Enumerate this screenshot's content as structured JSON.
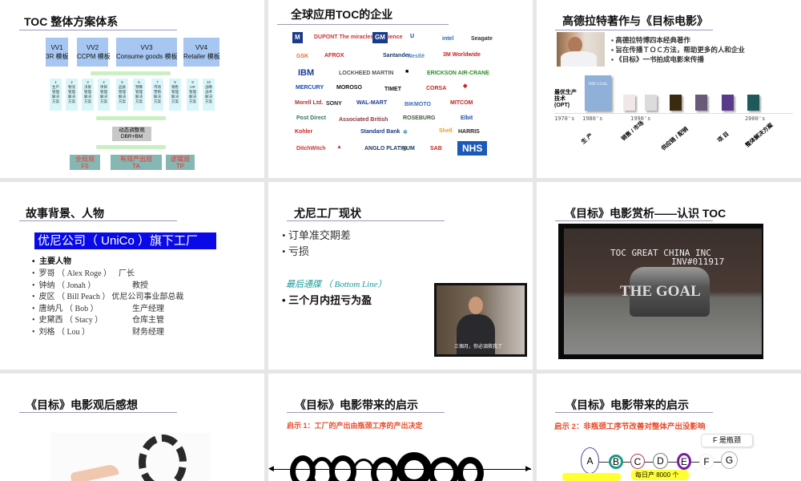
{
  "slide1": {
    "title": "TOC 整体方案体系",
    "vv": [
      {
        "l1": "VV1",
        "l2": "3R 模板"
      },
      {
        "l1": "VV2",
        "l2": "CCPM 模板"
      },
      {
        "l1": "VV3",
        "l2": "Consume goods 模板"
      },
      {
        "l1": "VV4",
        "l2": "Retailer 模板"
      }
    ],
    "solutions": [
      "1\n生产\n管理\n解决\n方案",
      "2\n物流\n管理\n解决\n方案",
      "3\n决策\n管理\n解决\n方案",
      "4\n项目\n管理\n解决\n方案",
      "5\n品质\n管理\n解决\n方案",
      "6\n预算\n管理\n解决\n方案",
      "7\n市场\n营销\n解决\n方案",
      "8\n销售\n管理\n解决\n方案",
      "9\nHR\n管理\n解决\n方案",
      "10\n战略\n战术\n解决\n方案"
    ],
    "dbr_l1": "动态调整观",
    "dbr_l2": "DBR+BM",
    "base": [
      {
        "l1": "全局观",
        "l2": "F5"
      },
      {
        "l1": "有效产出观",
        "l2": "TA"
      },
      {
        "l1": "逻辑观",
        "l2": "TP"
      }
    ]
  },
  "slide2": {
    "title": "全球应用TOC的企业",
    "logos": [
      "M",
      "DUPONT The miracles of science",
      "GM",
      "U",
      "intel",
      "Seagate",
      "GSK",
      "AFROX",
      "Santander",
      "Nestlé",
      "3M Worldwide",
      "IBM",
      "LOCKHEED MARTIN",
      "■",
      "ERICKSON AIR-CRANE",
      "MERCURY",
      "MOROSO",
      "TIMET",
      "CORSA",
      "◆",
      "Morell Ltd.",
      "SONY",
      "WAL-MART",
      "BIKMOTO",
      "MITCOM",
      "Post Direct",
      "Associated British",
      "ROSEBURG",
      "Elbit",
      "Kohler",
      "Standard Bank",
      "✲",
      "Shell",
      "HARRIS",
      "DitchWitch",
      "▲",
      "ANGLO PLATINUM",
      "◎",
      "SAB",
      "NHS"
    ]
  },
  "slide3": {
    "title": "高德拉特著作与《目标电影》",
    "bullets": [
      "高德拉特博四本经典著作",
      "旨在传播ＴＯＣ方法，帮助更多的人和企业",
      "《目标》一书拍成电影来传播"
    ],
    "opt_label": "最优生产\n技术\n(OPT)",
    "book_title": "THE GOAL",
    "years": [
      "1970's",
      "1980's",
      "1990's",
      "2000's"
    ],
    "areas": [
      "生  产",
      "销售 / 市场",
      "供应链 / 配销",
      "项  目",
      "整体解决方案"
    ]
  },
  "slide4": {
    "title": "故事背景、人物",
    "banner": "优尼公司（ UniCo ）旗下工厂",
    "heading": "主要人物",
    "people": [
      {
        "name": "罗哥 （ Alex Roge ）",
        "role": "厂长"
      },
      {
        "name": "钟纳 （ Jonah ）",
        "role": "教授"
      },
      {
        "name": "皮区 （ Bill Peach ）",
        "role": "优尼公司事业部总裁"
      },
      {
        "name": "唐纳凡 （ Bob ）",
        "role": "生产经理"
      },
      {
        "name": "史黛西 （ Stacy ）",
        "role": "仓库主管"
      },
      {
        "name": "刘格 （ Lou ）",
        "role": "财务经理"
      }
    ]
  },
  "slide5": {
    "title": "尤尼工厂现状",
    "bullets": [
      "订单准交期差",
      "亏损"
    ],
    "ultimatum": "最后通牒 （ Bottom Line）",
    "goal": "三个月内扭亏为盈",
    "caption": "三個月，你必須救我了"
  },
  "slide6": {
    "title": "《目标》电影赏析——认识 TOC",
    "overlay1": "TOC GREAT CHINA INC",
    "overlay2": "INV#011917",
    "movie_title": "THE GOAL"
  },
  "slide7": {
    "title": "《目标》电影观后感想"
  },
  "slide8": {
    "title": "《目标》电影带来的启示",
    "insight": "启示 1：工厂的产出由瓶颈工序的产出决定"
  },
  "slide9": {
    "title": "《目标》电影带来的启示",
    "insight": "启示 2：非瓶颈工序节改善对整体产出没影响",
    "callout": "F 是瓶颈",
    "nodes": [
      "A",
      "B",
      "C",
      "D",
      "E",
      "F",
      "G"
    ],
    "note": "每日产 8000 个"
  }
}
